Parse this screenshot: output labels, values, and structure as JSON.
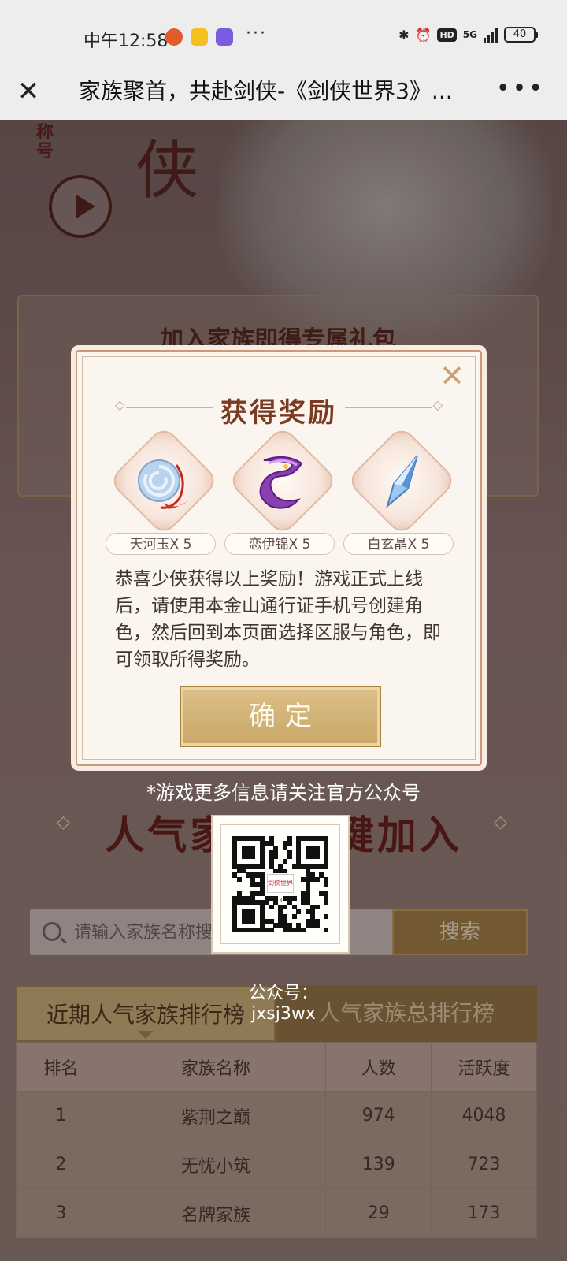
{
  "status_bar": {
    "time": "中午12:58",
    "more": "···",
    "network": "5G",
    "hd_badge": "HD",
    "battery": "40"
  },
  "title_bar": {
    "close_label": "✕",
    "title": "家族聚首，共赴剑侠-《剑侠世界3》...",
    "more_label": "•••"
  },
  "background": {
    "hero_brand": "侠",
    "hero_title": "称号",
    "gift_panel_title": "加入家族即得专属礼包",
    "section_title": "人气家族·一键加入",
    "search": {
      "placeholder": "请输入家族名称搜索",
      "button_label": "搜索"
    },
    "tabs": [
      {
        "label": "近期人气家族排行榜",
        "active": true
      },
      {
        "label": "人气家族总排行榜",
        "active": false
      }
    ],
    "table": {
      "headers": [
        "排名",
        "家族名称",
        "人数",
        "活跃度"
      ],
      "rows": [
        [
          "1",
          "紫荆之巅",
          "974",
          "4048"
        ],
        [
          "2",
          "无忧小筑",
          "139",
          "723"
        ],
        [
          "3",
          "名牌家族",
          "29",
          "173"
        ]
      ]
    }
  },
  "modal": {
    "title": "获得奖励",
    "close_label": "✕",
    "rewards": [
      {
        "label": "天河玉X 5",
        "icon": "jade-pendant-icon",
        "color": "#9fc3e6"
      },
      {
        "label": "恋伊锦X 5",
        "icon": "purple-silk-icon",
        "color": "#8a3fb3"
      },
      {
        "label": "白玄晶X 5",
        "icon": "crystal-icon",
        "color": "#7fb2e8"
      }
    ],
    "message": "恭喜少侠获得以上奖励！游戏正式上线后，请使用本金山通行证手机号创建角色，然后回到本页面选择区服与角色，即可领取所得奖励。",
    "confirm_label": "确定"
  },
  "follow_tip": "*游戏更多信息请关注官方公众号",
  "qr": {
    "logo_text": "剑侠世界3"
  },
  "official_account": {
    "label": "公众号：",
    "id": "jxsj3wx"
  }
}
